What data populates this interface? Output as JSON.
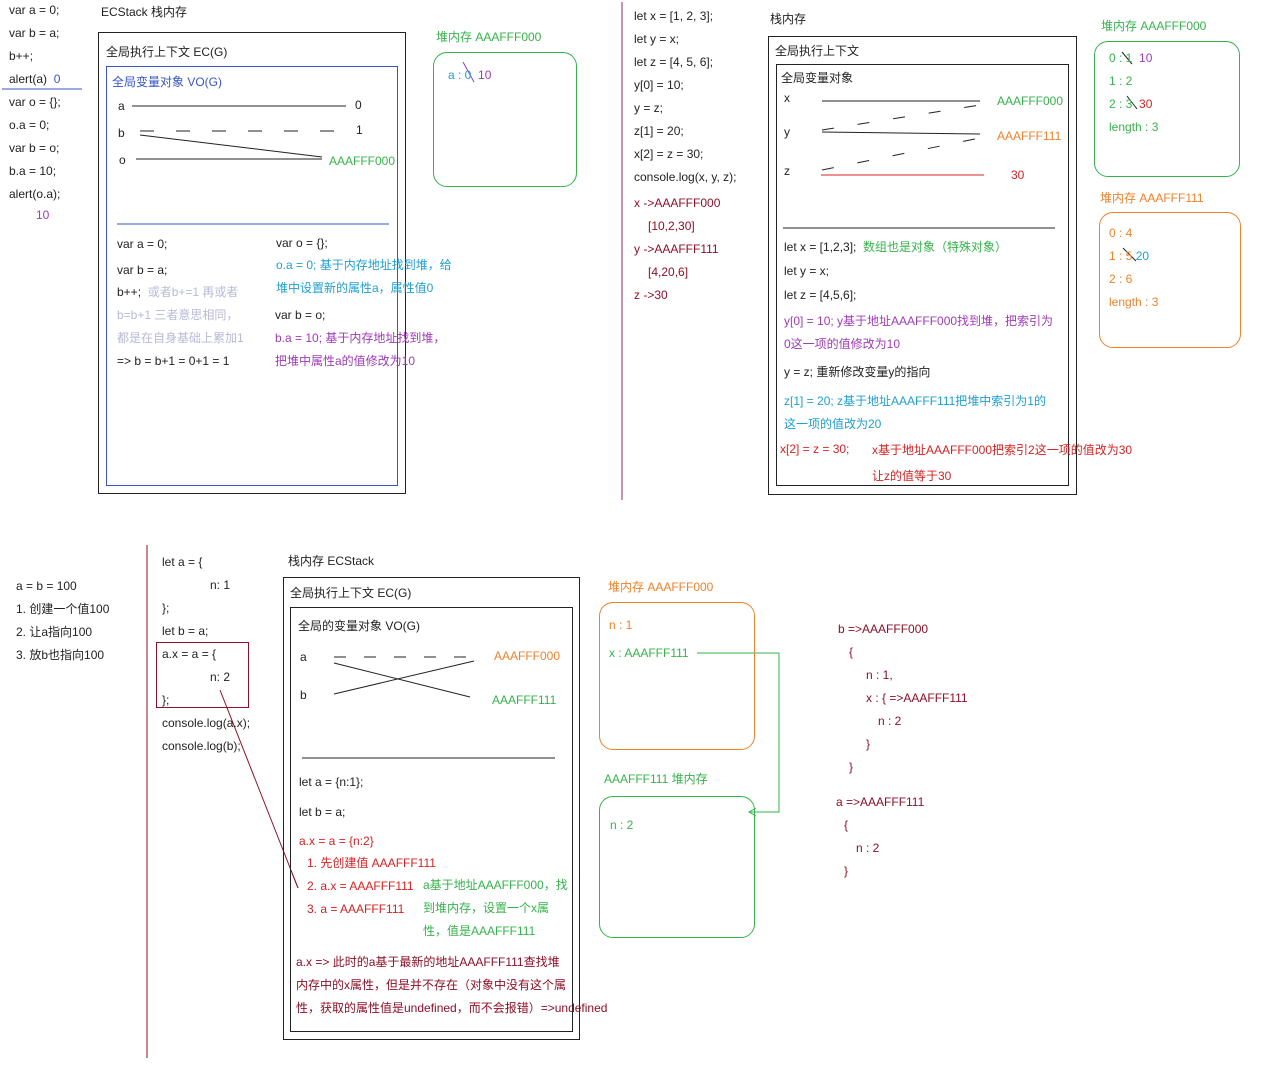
{
  "top_left_code": {
    "lines": [
      "var a = 0;",
      "var b = a;",
      "b++;",
      "alert(a)",
      "var o = {};",
      "o.a = 0;",
      "var b = o;",
      "b.a = 10;",
      "alert(o.a);"
    ],
    "alert_a_result": "0",
    "alert_oa_result": "10"
  },
  "panel1": {
    "title": "ECStack 栈内存",
    "ec_title": "全局执行上下文 EC(G)",
    "vo_title": "全局变量对象 VO(G)",
    "vars": [
      {
        "name": "a",
        "value": "0"
      },
      {
        "name": "b",
        "value": "1"
      },
      {
        "name": "o",
        "value": "AAAFFF000"
      }
    ],
    "left_notes": {
      "l1": "var a = 0;",
      "l2": "var b = a;",
      "l3a": "b++;",
      "l3b": "或者b+=1 再或者",
      "l4": "b=b+1 三者意思相同，",
      "l5": "都是在自身基础上累加1",
      "l6": "=> b = b+1 = 0+1 = 1"
    },
    "right_notes": {
      "r1": "var o = {};",
      "r2": "o.a = 0;  基于内存地址找到堆，给",
      "r3": "堆中设置新的属性a，属性值0",
      "r4": "var b = o;",
      "r5": "b.a = 10;  基于内存地址找到堆，",
      "r6": "把堆中属性a的值修改为10"
    },
    "heap_title": "堆内存 AAAFFF000",
    "heap_line": "a : 0",
    "heap_new": "10"
  },
  "panel2": {
    "code": [
      "let x = [1, 2, 3];",
      "let y = x;",
      "let z = [4, 5, 6];",
      "y[0] = 10;",
      "y = z;",
      "z[1] = 20;",
      "x[2] = z = 30;",
      "console.log(x, y, z);"
    ],
    "results": [
      "x ->AAAFFF000",
      "[10,2,30]",
      "y ->AAAFFF111",
      "[4,20,6]",
      "z ->30"
    ],
    "stack_title": "栈内存",
    "ec_title": "全局执行上下文",
    "vo_title": "全局变量对象",
    "vars": [
      {
        "name": "x",
        "value": "AAAFFF000"
      },
      {
        "name": "y",
        "value": "AAAFFF111"
      },
      {
        "name": "z",
        "value": "30"
      }
    ],
    "notes": {
      "n1": "let x = [1,2,3];",
      "n1b": "数组也是对象（特殊对象）",
      "n2": "let y = x;",
      "n3": "let z = [4,5,6];",
      "n4": "y[0] = 10;  y基于地址AAAFFF000找到堆，把索引为",
      "n4b": "0这一项的值修改为10",
      "n5": "y = z;  重新修改变量y的指向",
      "n6": "z[1] = 20;   z基于地址AAAFFF111把堆中索引为1的",
      "n6b": "这一项的值改为20",
      "n7": "x[2] = z = 30;",
      "n7b": "x基于地址AAAFFF000把索引2这一项的值改为30",
      "n7c": "让z的值等于30"
    },
    "heap0_title": "堆内存  AAAFFF000",
    "heap0": {
      "i0": "0 : 1",
      "i0new": "10",
      "i1": "1 : 2",
      "i2": "2 : 3",
      "i2new": "30",
      "len": "length : 3"
    },
    "heap1_title": "堆内存 AAAFFF111",
    "heap1": {
      "i0": "0 : 4",
      "i1": "1 : 5",
      "i1new": "20",
      "i2": "2 : 6",
      "len": "length : 3"
    }
  },
  "panel3": {
    "intro": [
      "a = b = 100",
      "1. 创建一个值100",
      "2. 让a指向100",
      "3. 放b也指向100"
    ],
    "code": [
      "let a = {",
      "n: 1",
      "};",
      "let b = a;",
      "a.x = a = {",
      "n: 2",
      "};",
      "console.log(a.x);",
      "console.log(b);"
    ],
    "stack_title": "栈内存  ECStack",
    "ec_title": "全局执行上下文   EC(G)",
    "vo_title": "全局的变量对象  VO(G)",
    "vars": [
      {
        "name": "a",
        "value": "AAAFFF000"
      },
      {
        "name": "b",
        "value": "AAAFFF111"
      }
    ],
    "notes": {
      "n1": "let a = {n:1};",
      "n2": "let b = a;",
      "n3": "a.x = a = {n:2}",
      "s1": "1. 先创建值 AAAFFF111",
      "s2": "2. a.x = AAAFFF111",
      "s2g": "a基于地址AAAFFF000，找",
      "s2g2": "到堆内存，设置一个x属",
      "s2g3": "性，值是AAAFFF111",
      "s3": "3. a = AAAFFF111",
      "f1": "a.x  => 此时的a基于最新的地址AAAFFF111查找堆",
      "f2": "内存中的x属性，但是并不存在（对象中没有这个属",
      "f3": "性，获取的属性值是undefined，而不会报错）=>undefined"
    },
    "heap0_title": "堆内存 AAAFFF000",
    "heap0": {
      "n": "n : 1",
      "x": "x : AAAFFF111"
    },
    "heap1_title": "AAAFFF111  堆内存",
    "heap1": {
      "n": "n : 2"
    },
    "result_b": [
      "b =>AAAFFF000",
      "{",
      "n : 1,",
      "x : {  =>AAAFFF111",
      "n : 2",
      "}",
      "}"
    ],
    "result_a": [
      "a =>AAAFFF111",
      "{",
      "n : 2",
      "}"
    ]
  }
}
